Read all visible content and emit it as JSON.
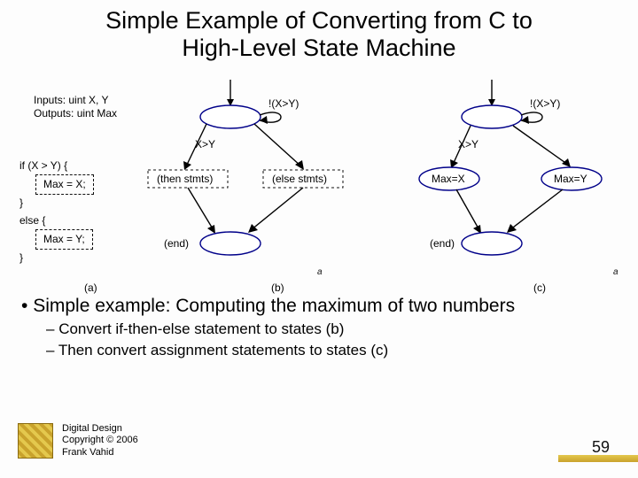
{
  "title_line1": "Simple Example of Converting from C to",
  "title_line2": "High-Level State Machine",
  "io": {
    "inputs": "Inputs: uint X, Y",
    "outputs": "Outputs: uint Max"
  },
  "code": {
    "if_line": "if (X > Y) {",
    "max_x": "Max = X;",
    "close1": "}",
    "else_line": "else {",
    "max_y": "Max = Y;",
    "close2": "}"
  },
  "labels": {
    "a": "(a)",
    "b": "(b)",
    "c": "(c)",
    "mini_a": "a"
  },
  "panel_b": {
    "cond_false": "!(X>Y)",
    "cond_true": "X>Y",
    "then": "(then stmts)",
    "else": "(else stmts)",
    "end": "(end)"
  },
  "panel_c": {
    "cond_false": "!(X>Y)",
    "cond_true": "X>Y",
    "maxx": "Max=X",
    "maxy": "Max=Y",
    "end": "(end)"
  },
  "bullets": {
    "main": "Simple example: Computing the maximum of two numbers",
    "sub1": "Convert if-then-else statement to states (b)",
    "sub2": "Then convert assignment statements to states (c)"
  },
  "footer": {
    "l1": "Digital Design",
    "l2": "Copyright © 2006",
    "l3": "Frank Vahid"
  },
  "page": "59"
}
